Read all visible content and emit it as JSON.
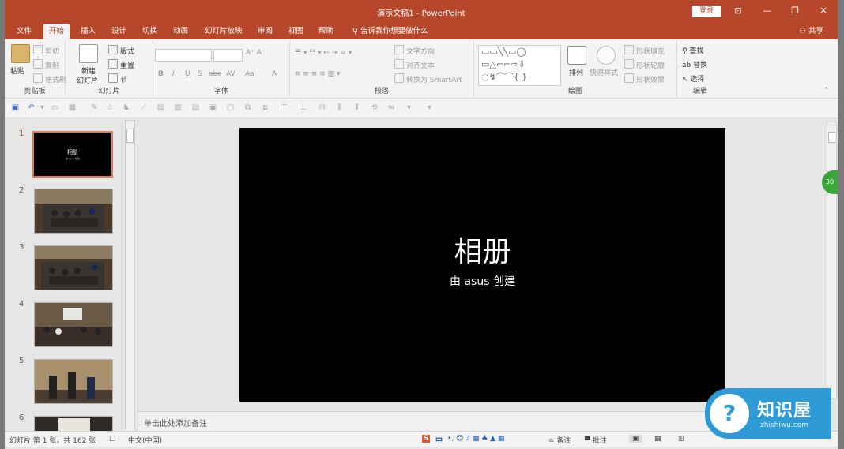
{
  "window": {
    "title": "演示文稿1 - PowerPoint",
    "login_label": "登录",
    "share_label": "共享",
    "controls": [
      "⊡",
      "—",
      "❐",
      "✕"
    ]
  },
  "tabs": [
    "文件",
    "开始",
    "插入",
    "设计",
    "切换",
    "动画",
    "幻灯片放映",
    "审阅",
    "视图",
    "帮助"
  ],
  "active_tab": "开始",
  "tell_me": "告诉我你想要做什么",
  "ribbon": {
    "clipboard": {
      "label": "剪贴板",
      "paste": "粘贴",
      "cut": "剪切",
      "copy": "复制",
      "format_painter": "格式刷"
    },
    "slides": {
      "label": "幻灯片",
      "new_slide_1": "新建",
      "new_slide_2": "幻灯片",
      "layout": "版式",
      "reset": "重置",
      "section": "节"
    },
    "font": {
      "label": "字体",
      "font_name": "",
      "font_size": "",
      "bold": "B",
      "italic": "I",
      "underline": "U",
      "shadow": "S",
      "strike": "abc",
      "spacing": "AV",
      "case": "Aa",
      "color": "A"
    },
    "paragraph": {
      "label": "段落",
      "text_direction": "文字方向",
      "align_text": "对齐文本",
      "smartart": "转换为 SmartArt"
    },
    "drawing": {
      "label": "绘图",
      "arrange": "排列",
      "quick_styles": "快速样式",
      "shape_fill": "形状填充",
      "shape_outline": "形状轮廓",
      "shape_effects": "形状效果"
    },
    "editing": {
      "label": "编辑",
      "find": "查找",
      "replace": "替换",
      "select": "选择"
    }
  },
  "thumbnails": [
    {
      "num": "1",
      "title": "相册",
      "sub": "由 asus 创建",
      "selected": true
    },
    {
      "num": "2",
      "selected": false
    },
    {
      "num": "3",
      "selected": false
    },
    {
      "num": "4",
      "selected": false
    },
    {
      "num": "5",
      "selected": false
    },
    {
      "num": "6",
      "selected": false
    }
  ],
  "slide": {
    "title": "相册",
    "subtitle": "由 asus 创建"
  },
  "notes_placeholder": "单击此处添加备注",
  "status": {
    "slide_info": "幻灯片 第 1 张，共 162 张",
    "language": "中文(中国)",
    "ime": "中",
    "notes": "备注",
    "comments": "批注"
  },
  "watermark": {
    "brand": "知识屋",
    "url": "zhishiwu.com",
    "glyph": "?"
  },
  "side_badge": "30",
  "colors": {
    "accent": "#b7472a",
    "watermark": "#2e9bd6"
  }
}
